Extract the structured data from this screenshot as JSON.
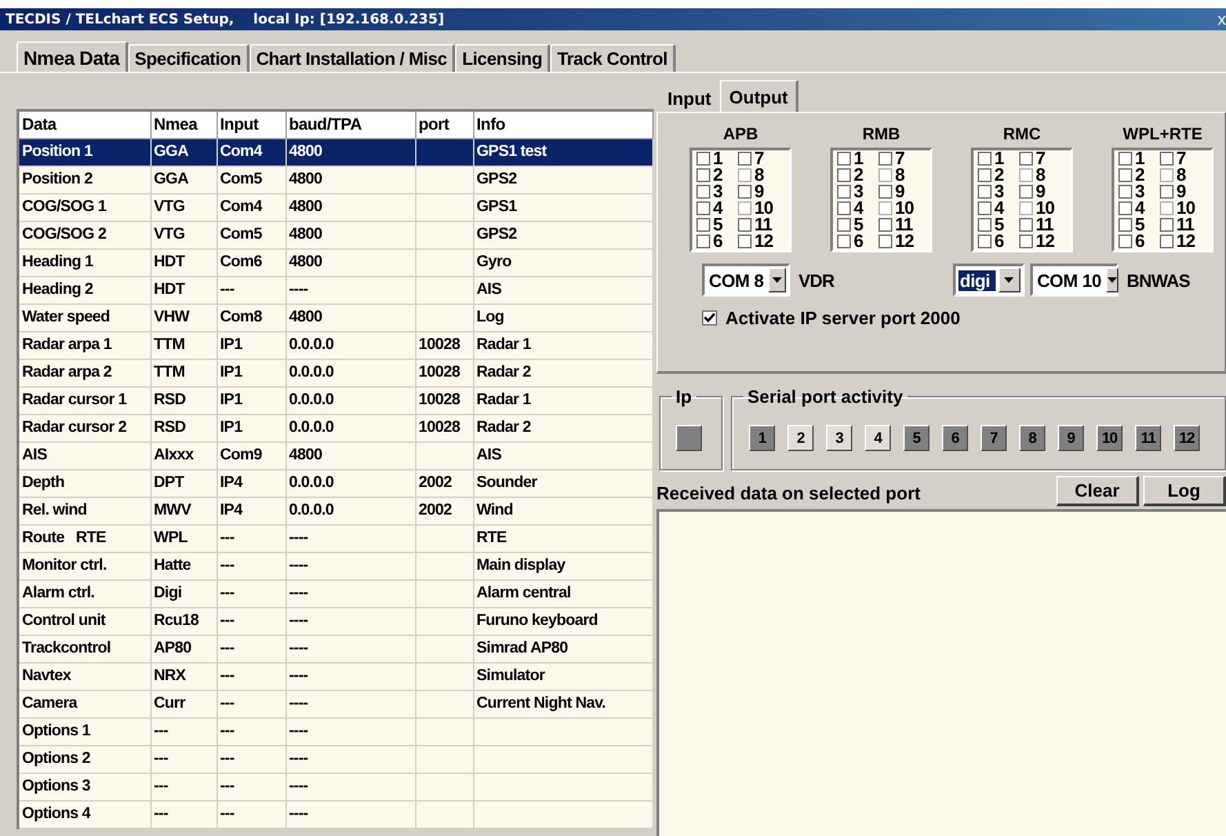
{
  "window": {
    "title": "TECDIS / TELchart ECS Setup,    local Ip: [192.168.0.235]",
    "close": "x"
  },
  "tabs": [
    {
      "label": "Nmea Data",
      "selected": true
    },
    {
      "label": "Specification",
      "selected": false
    },
    {
      "label": "Chart Installation / Misc",
      "selected": false
    },
    {
      "label": "Licensing",
      "selected": false
    },
    {
      "label": "Track Control",
      "selected": false
    }
  ],
  "table": {
    "columns": [
      "Data",
      "Nmea",
      "Input",
      "baud/TPA",
      "port",
      "Info"
    ],
    "rows": [
      {
        "cells": [
          "Position 1",
          "GGA",
          "Com4",
          "4800",
          "",
          "GPS1 test"
        ],
        "selected": true
      },
      {
        "cells": [
          "Position 2",
          "GGA",
          "Com5",
          "4800",
          "",
          "GPS2"
        ],
        "selected": false
      },
      {
        "cells": [
          "COG/SOG 1",
          "VTG",
          "Com4",
          "4800",
          "",
          "GPS1"
        ],
        "selected": false
      },
      {
        "cells": [
          "COG/SOG 2",
          "VTG",
          "Com5",
          "4800",
          "",
          "GPS2"
        ],
        "selected": false
      },
      {
        "cells": [
          "Heading 1",
          "HDT",
          "Com6",
          "4800",
          "",
          "Gyro"
        ],
        "selected": false
      },
      {
        "cells": [
          "Heading 2",
          "HDT",
          "---",
          "----",
          "",
          "AIS"
        ],
        "selected": false
      },
      {
        "cells": [
          "Water speed",
          "VHW",
          "Com8",
          "4800",
          "",
          "Log"
        ],
        "selected": false
      },
      {
        "cells": [
          "Radar arpa 1",
          "TTM",
          "IP1",
          "0.0.0.0",
          "10028",
          "Radar 1"
        ],
        "selected": false
      },
      {
        "cells": [
          "Radar arpa 2",
          "TTM",
          "IP1",
          "0.0.0.0",
          "10028",
          "Radar 2"
        ],
        "selected": false
      },
      {
        "cells": [
          "Radar cursor 1",
          "RSD",
          "IP1",
          "0.0.0.0",
          "10028",
          "Radar 1"
        ],
        "selected": false
      },
      {
        "cells": [
          "Radar cursor 2",
          "RSD",
          "IP1",
          "0.0.0.0",
          "10028",
          "Radar 2"
        ],
        "selected": false
      },
      {
        "cells": [
          "AIS",
          "AIxxx",
          "Com9",
          "4800",
          "",
          "AIS"
        ],
        "selected": false
      },
      {
        "cells": [
          "Depth",
          "DPT",
          "IP4",
          "0.0.0.0",
          "2002",
          "Sounder"
        ],
        "selected": false
      },
      {
        "cells": [
          "Rel. wind",
          "MWV",
          "IP4",
          "0.0.0.0",
          "2002",
          "Wind"
        ],
        "selected": false
      },
      {
        "cells": [
          "Route   RTE",
          "WPL",
          "---",
          "----",
          "",
          "RTE"
        ],
        "selected": false
      },
      {
        "cells": [
          "Monitor ctrl.",
          "Hatte",
          "---",
          "----",
          "",
          "Main display"
        ],
        "selected": false
      },
      {
        "cells": [
          "Alarm ctrl.",
          "Digi",
          "---",
          "----",
          "",
          "Alarm central"
        ],
        "selected": false
      },
      {
        "cells": [
          "Control unit",
          "Rcu18",
          "---",
          "----",
          "",
          "Furuno keyboard"
        ],
        "selected": false
      },
      {
        "cells": [
          "Trackcontrol",
          "AP80",
          "---",
          "----",
          "",
          "Simrad AP80"
        ],
        "selected": false
      },
      {
        "cells": [
          "Navtex",
          "NRX",
          "---",
          "----",
          "",
          "Simulator"
        ],
        "selected": false
      },
      {
        "cells": [
          "Camera",
          "Curr",
          "---",
          "----",
          "",
          "Current Night Nav."
        ],
        "selected": false
      },
      {
        "cells": [
          "Options 1",
          "---",
          "---",
          "----",
          "",
          ""
        ],
        "selected": false
      },
      {
        "cells": [
          "Options 2",
          "---",
          "---",
          "----",
          "",
          ""
        ],
        "selected": false
      },
      {
        "cells": [
          "Options 3",
          "---",
          "---",
          "----",
          "",
          ""
        ],
        "selected": false
      },
      {
        "cells": [
          "Options 4",
          "---",
          "---",
          "----",
          "",
          ""
        ],
        "selected": false
      }
    ]
  },
  "io_tabs": [
    {
      "label": "Input",
      "selected": false
    },
    {
      "label": "Output",
      "selected": true
    }
  ],
  "output_groups": [
    {
      "title": "APB",
      "channels": [
        {
          "label": "1",
          "checked": false,
          "disabled": false
        },
        {
          "label": "2",
          "checked": false,
          "disabled": false
        },
        {
          "label": "3",
          "checked": false,
          "disabled": false
        },
        {
          "label": "4",
          "checked": false,
          "disabled": false
        },
        {
          "label": "5",
          "checked": false,
          "disabled": false
        },
        {
          "label": "6",
          "checked": false,
          "disabled": false
        },
        {
          "label": "7",
          "checked": false,
          "disabled": false
        },
        {
          "label": "8",
          "checked": false,
          "disabled": true
        },
        {
          "label": "9",
          "checked": false,
          "disabled": false
        },
        {
          "label": "10",
          "checked": false,
          "disabled": true
        },
        {
          "label": "11",
          "checked": false,
          "disabled": false
        },
        {
          "label": "12",
          "checked": false,
          "disabled": false
        }
      ]
    },
    {
      "title": "RMB",
      "channels": [
        {
          "label": "1",
          "checked": false,
          "disabled": false
        },
        {
          "label": "2",
          "checked": false,
          "disabled": false
        },
        {
          "label": "3",
          "checked": false,
          "disabled": false
        },
        {
          "label": "4",
          "checked": false,
          "disabled": false
        },
        {
          "label": "5",
          "checked": false,
          "disabled": false
        },
        {
          "label": "6",
          "checked": false,
          "disabled": false
        },
        {
          "label": "7",
          "checked": false,
          "disabled": false
        },
        {
          "label": "8",
          "checked": false,
          "disabled": true
        },
        {
          "label": "9",
          "checked": false,
          "disabled": false
        },
        {
          "label": "10",
          "checked": false,
          "disabled": true
        },
        {
          "label": "11",
          "checked": false,
          "disabled": false
        },
        {
          "label": "12",
          "checked": false,
          "disabled": false
        }
      ]
    },
    {
      "title": "RMC",
      "channels": [
        {
          "label": "1",
          "checked": false,
          "disabled": false
        },
        {
          "label": "2",
          "checked": false,
          "disabled": false
        },
        {
          "label": "3",
          "checked": false,
          "disabled": false
        },
        {
          "label": "4",
          "checked": false,
          "disabled": false
        },
        {
          "label": "5",
          "checked": false,
          "disabled": false
        },
        {
          "label": "6",
          "checked": false,
          "disabled": false
        },
        {
          "label": "7",
          "checked": false,
          "disabled": false
        },
        {
          "label": "8",
          "checked": false,
          "disabled": true
        },
        {
          "label": "9",
          "checked": false,
          "disabled": false
        },
        {
          "label": "10",
          "checked": false,
          "disabled": true
        },
        {
          "label": "11",
          "checked": false,
          "disabled": false
        },
        {
          "label": "12",
          "checked": false,
          "disabled": false
        }
      ]
    },
    {
      "title": "WPL+RTE",
      "channels": [
        {
          "label": "1",
          "checked": false,
          "disabled": false
        },
        {
          "label": "2",
          "checked": false,
          "disabled": false
        },
        {
          "label": "3",
          "checked": false,
          "disabled": false
        },
        {
          "label": "4",
          "checked": false,
          "disabled": false
        },
        {
          "label": "5",
          "checked": false,
          "disabled": false
        },
        {
          "label": "6",
          "checked": false,
          "disabled": false
        },
        {
          "label": "7",
          "checked": false,
          "disabled": false
        },
        {
          "label": "8",
          "checked": false,
          "disabled": true
        },
        {
          "label": "9",
          "checked": false,
          "disabled": false
        },
        {
          "label": "10",
          "checked": false,
          "disabled": true
        },
        {
          "label": "11",
          "checked": false,
          "disabled": false
        },
        {
          "label": "12",
          "checked": false,
          "disabled": false
        }
      ]
    }
  ],
  "port_selects": [
    {
      "value": "COM 8",
      "highlighted": false,
      "label": "VDR"
    },
    {
      "value": "digi",
      "highlighted": true
    },
    {
      "value": "COM 10",
      "highlighted": false,
      "label": "BNWAS"
    }
  ],
  "ip_server": {
    "label": "Activate IP server port 2000",
    "checked": true
  },
  "ip_group": {
    "title": "Ip",
    "active": true
  },
  "serial_activity": {
    "title": "Serial port activity",
    "ports": [
      {
        "label": "1",
        "active": true
      },
      {
        "label": "2",
        "active": false
      },
      {
        "label": "3",
        "active": false
      },
      {
        "label": "4",
        "active": false
      },
      {
        "label": "5",
        "active": true
      },
      {
        "label": "6",
        "active": true
      },
      {
        "label": "7",
        "active": true
      },
      {
        "label": "8",
        "active": true
      },
      {
        "label": "9",
        "active": true
      },
      {
        "label": "10",
        "active": true
      },
      {
        "label": "11",
        "active": true
      },
      {
        "label": "12",
        "active": true
      }
    ]
  },
  "received": {
    "label": "Received data on selected port",
    "buttons": [
      "Clear",
      "Log"
    ]
  }
}
